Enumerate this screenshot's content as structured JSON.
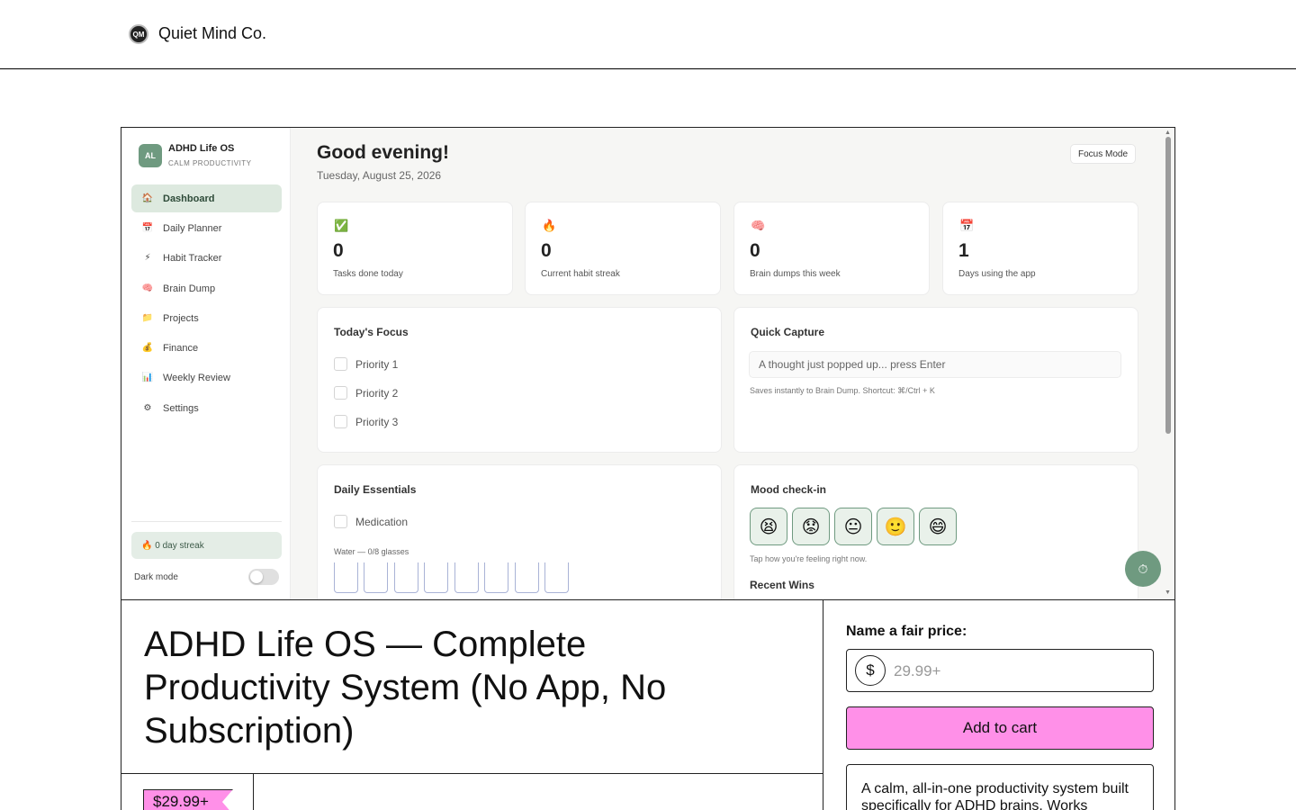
{
  "header": {
    "logo_text": "QM",
    "brand": "Quiet Mind Co."
  },
  "app": {
    "badge": "AL",
    "name": "ADHD Life OS",
    "subtitle": "CALM PRODUCTIVITY",
    "nav": [
      {
        "label": "Dashboard",
        "icon": "🏠"
      },
      {
        "label": "Daily Planner",
        "icon": "📅"
      },
      {
        "label": "Habit Tracker",
        "icon": "⚡"
      },
      {
        "label": "Brain Dump",
        "icon": "🧠"
      },
      {
        "label": "Projects",
        "icon": "📁"
      },
      {
        "label": "Finance",
        "icon": "💰"
      },
      {
        "label": "Weekly Review",
        "icon": "📊"
      },
      {
        "label": "Settings",
        "icon": "⚙"
      }
    ],
    "streak": "🔥 0 day streak",
    "dark_mode": "Dark mode",
    "greeting": "Good evening!",
    "date": "Tuesday, August 25, 2026",
    "focus_mode": "Focus Mode",
    "stats": [
      {
        "icon": "✅",
        "value": "0",
        "label": "Tasks done today"
      },
      {
        "icon": "🔥",
        "value": "0",
        "label": "Current habit streak"
      },
      {
        "icon": "🧠",
        "value": "0",
        "label": "Brain dumps this week"
      },
      {
        "icon": "📅",
        "value": "1",
        "label": "Days using the app"
      }
    ],
    "focus": {
      "title": "Today's Focus",
      "items": [
        "Priority 1",
        "Priority 2",
        "Priority 3"
      ]
    },
    "capture": {
      "title": "Quick Capture",
      "placeholder": "A thought just popped up... press Enter",
      "hint": "Saves instantly to Brain Dump. Shortcut: ⌘/Ctrl + K"
    },
    "essentials": {
      "title": "Daily Essentials",
      "medication": "Medication",
      "water": "Water — 0/8 glasses"
    },
    "mood": {
      "title": "Mood check-in",
      "options": [
        "😫",
        "😟",
        "😐",
        "🙂",
        "😄"
      ],
      "hint": "Tap how you're feeling right now.",
      "recent_wins": "Recent Wins"
    },
    "fab_icon": "⏱"
  },
  "product": {
    "title": "ADHD Life OS — Complete Productivity System (No App, No Subscription)",
    "price": "$29.99+",
    "fair_price_label": "Name a fair price:",
    "currency": "$",
    "price_placeholder": "29.99+",
    "add_to_cart": "Add to cart",
    "description": "A calm, all-in-one productivity system built specifically for ADHD brains. Works"
  }
}
